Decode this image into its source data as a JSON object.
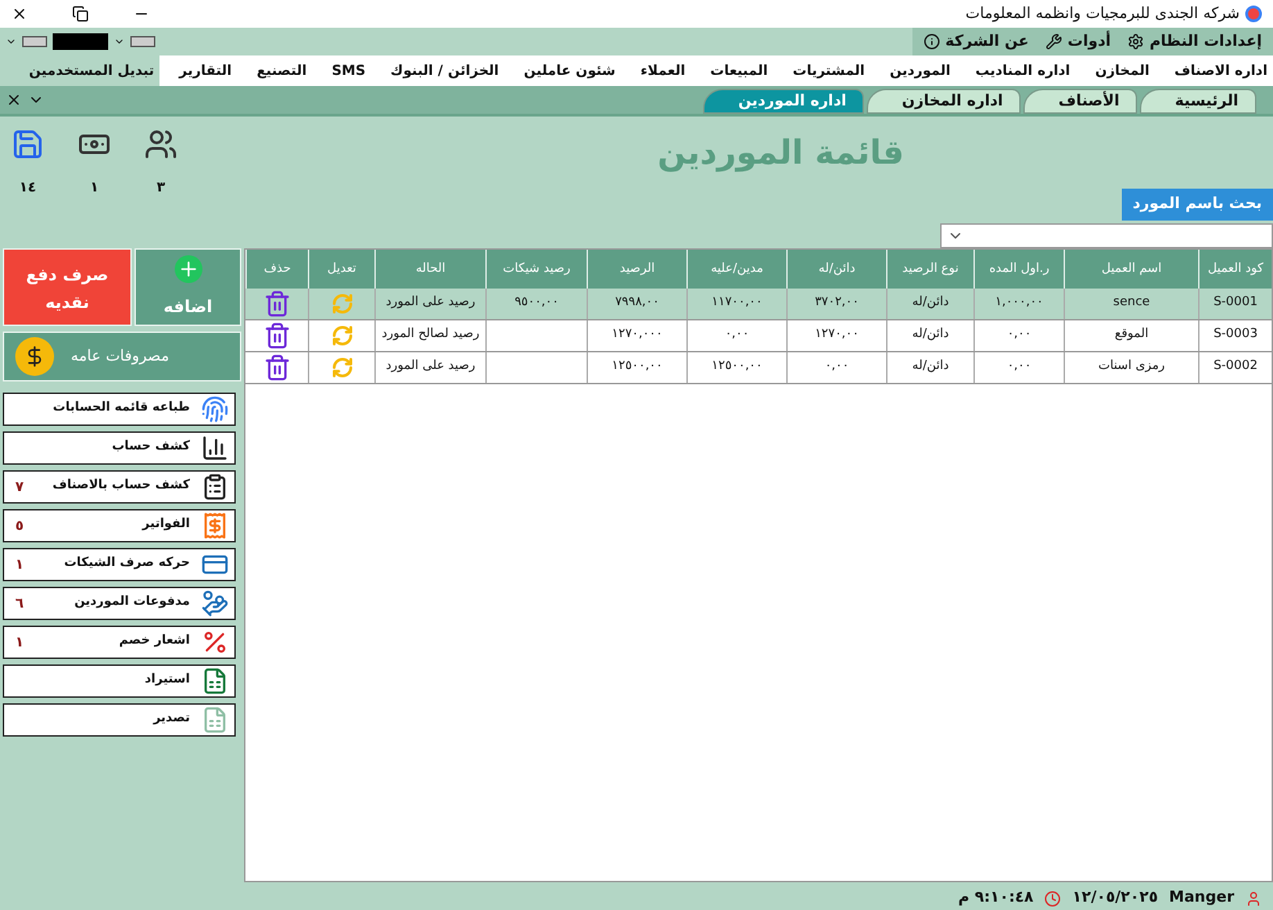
{
  "window": {
    "title": "شركه الجندى للبرمجيات وانظمه المعلومات"
  },
  "top_menu": [
    "إعدادات النظام",
    "أدوات",
    "عن الشركة"
  ],
  "menu": [
    "اداره الاصناف",
    "المخازن",
    "اداره المناديب",
    "الموردين",
    "المشتريات",
    "المبيعات",
    "العملاء",
    "شئون عاملين",
    "الخزائن / البنوك",
    "SMS",
    "التصنيع",
    "التقارير",
    "تبديل المستخدمين"
  ],
  "tabs": [
    {
      "label": "الرئيسية",
      "selected": false
    },
    {
      "label": "الأصناف",
      "selected": false
    },
    {
      "label": "اداره المخازن",
      "selected": false
    },
    {
      "label": "اداره الموردين",
      "selected": true
    }
  ],
  "quick_icons": [
    {
      "kind": "users",
      "count": "٣"
    },
    {
      "kind": "money",
      "count": "١"
    },
    {
      "kind": "save",
      "count": "١٤"
    }
  ],
  "heading": "قائمة الموردين",
  "search": {
    "label": "بحث باسم المورد"
  },
  "table": {
    "columns": [
      "كود العميل",
      "اسم العميل",
      "ر.اول المده",
      "نوع الرصيد",
      "دائن/له",
      "مدين/عليه",
      "الرصيد",
      "رصيد شيكات",
      "الحاله",
      "تعديل",
      "حذف"
    ],
    "rows": [
      {
        "selected": true,
        "cells": [
          "S-0001",
          "sence",
          "١,٠٠٠,٠٠",
          "دائن/له",
          "٣٧٠٢,٠٠",
          "١١٧٠٠,٠٠",
          "٧٩٩٨,٠٠",
          "٩٥٠٠,٠٠",
          "رصيد على المورد"
        ]
      },
      {
        "selected": false,
        "cells": [
          "S-0003",
          "الموقع",
          "٠,٠٠",
          "دائن/له",
          "١٢٧٠,٠٠",
          "٠,٠٠",
          "١٢٧٠,٠٠٠",
          "",
          "رصيد لصالح المورد"
        ]
      },
      {
        "selected": false,
        "cells": [
          "S-0002",
          "رمزى اسنات",
          "٠,٠٠",
          "دائن/له",
          "٠,٠٠",
          "١٢٥٠٠,٠٠",
          "١٢٥٠٠,٠٠",
          "",
          "رصيد على المورد"
        ]
      }
    ]
  },
  "actions": [
    {
      "kind": "add",
      "label": "اضافه"
    },
    {
      "kind": "cash",
      "label": "صرف دفع نقديه"
    },
    {
      "kind": "expenses",
      "label": "مصروفات عامه"
    }
  ],
  "reports": [
    {
      "kind": "print",
      "label": "طباعه قائمه الحسابات"
    },
    {
      "kind": "chart",
      "label": "كشف حساب"
    },
    {
      "kind": "list",
      "label": "كشف حساب بالاصناف",
      "count": "٧"
    },
    {
      "kind": "invoice",
      "label": "الفواتير",
      "count": "٥"
    },
    {
      "kind": "card",
      "label": "حركه صرف الشيكات",
      "count": "١"
    },
    {
      "kind": "payment",
      "label": "مدفوعات الموردين",
      "count": "٦"
    },
    {
      "kind": "discount",
      "label": "اشعار خصم",
      "count": "١"
    },
    {
      "kind": "import",
      "label": "استيراد"
    },
    {
      "kind": "export",
      "label": "تصدير"
    }
  ],
  "status_bar": {
    "user": "Manger",
    "date": "١٢/٠٥/٢٠٢٥",
    "time": "٩:١٠:٤٨ م"
  }
}
